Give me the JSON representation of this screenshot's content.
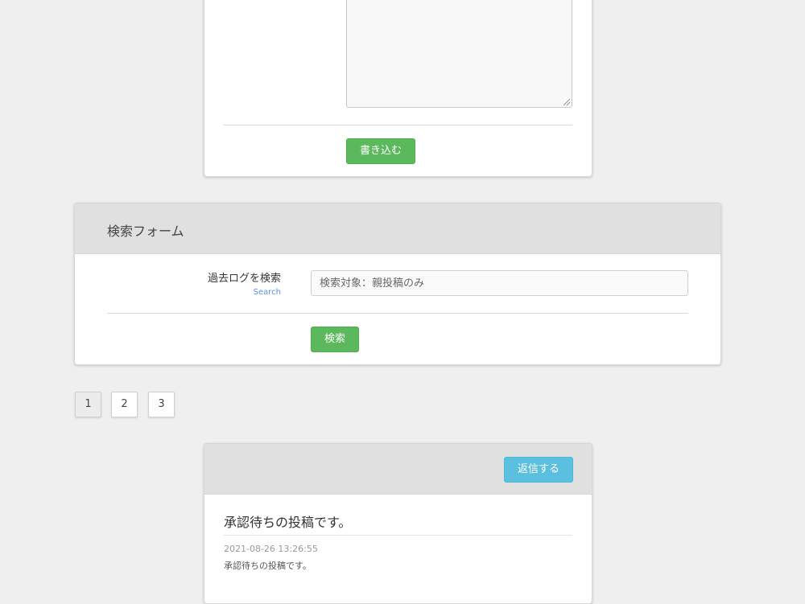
{
  "post_form": {
    "submit_label": "書き込む"
  },
  "search_form": {
    "title": "検索フォーム",
    "label": "過去ログを検索",
    "sublabel": "Search",
    "placeholder": "検索対象：親投稿のみ",
    "button_label": "検索"
  },
  "pagination": {
    "pages": [
      "1",
      "2",
      "3"
    ],
    "current": "1"
  },
  "post": {
    "reply_label": "返信する",
    "title": "承認待ちの投稿です。",
    "date": "2021-08-26 13:26:55",
    "body": "承認待ちの投稿です。"
  }
}
